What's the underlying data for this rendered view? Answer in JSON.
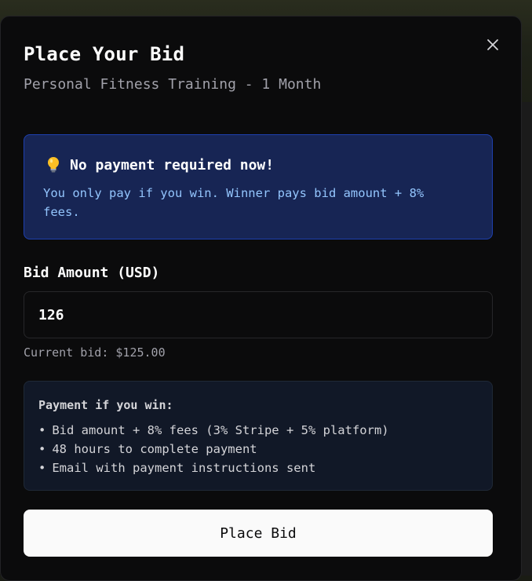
{
  "modal": {
    "title": "Place Your Bid",
    "subtitle": "Personal Fitness Training - 1 Month",
    "close_icon": "close-icon"
  },
  "info": {
    "icon": "lightbulb-icon",
    "heading": "No payment required now!",
    "text": "You only pay if you win. Winner pays bid amount + 8% fees."
  },
  "bid": {
    "label": "Bid Amount (USD)",
    "value": "126",
    "current": "Current bid: $125.00"
  },
  "payment": {
    "title": "Payment if you win:",
    "items": [
      "Bid amount + 8% fees (3% Stripe + 5% platform)",
      "48 hours to complete payment",
      "Email with payment instructions sent"
    ]
  },
  "actions": {
    "place_bid_label": "Place Bid"
  },
  "colors": {
    "info_bg": "#172554",
    "info_text": "#93c5fd",
    "button_bg": "#fafafa",
    "modal_bg": "#0b0b0c"
  }
}
